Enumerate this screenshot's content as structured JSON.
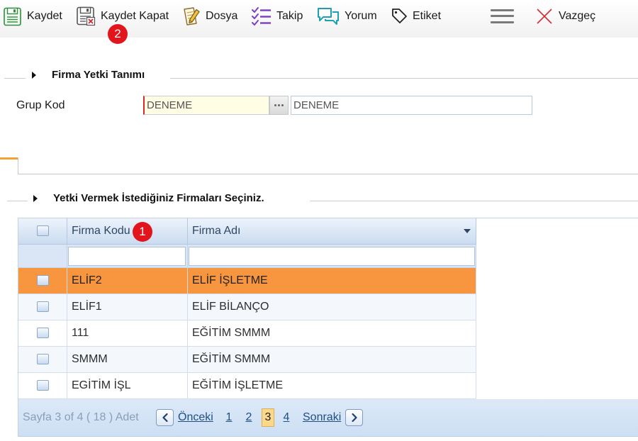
{
  "toolbar": {
    "items": [
      {
        "label": "Kaydet",
        "icon": "save-icon"
      },
      {
        "label": "Kaydet Kapat",
        "icon": "save-close-icon"
      },
      {
        "label": "Dosya",
        "icon": "file-edit-icon"
      },
      {
        "label": "Takip",
        "icon": "checklist-icon"
      },
      {
        "label": "Yorum",
        "icon": "comments-icon"
      },
      {
        "label": "Etiket",
        "icon": "tag-icon"
      }
    ],
    "menu_icon": "hamburger-menu-icon",
    "cancel": {
      "label": "Vazgeç",
      "icon": "close-icon"
    }
  },
  "annotations": {
    "marker_1": "1",
    "marker_2": "2"
  },
  "form": {
    "section_title": "Firma Yetki Tanımı",
    "group_code": {
      "label": "Grup Kod",
      "code_value": "DENEME",
      "name_value": "DENEME",
      "lookup_icon": "ellipsis-icon"
    }
  },
  "firm_selection": {
    "section_title": "Yetki Vermek İstediğiniz Firmaları Seçiniz."
  },
  "grid": {
    "columns": {
      "code": "Firma Kodu",
      "name": "Firma Adı"
    },
    "filters": {
      "code": "",
      "name": ""
    },
    "rows": [
      {
        "code": "ELİF2",
        "name": "ELİF İŞLETME",
        "selected": true,
        "checked": false
      },
      {
        "code": "ELİF1",
        "name": "ELİF BİLANÇO",
        "selected": false,
        "checked": false
      },
      {
        "code": "111",
        "name": "EĞİTİM SMMM",
        "selected": false,
        "checked": false
      },
      {
        "code": "SMMM",
        "name": "EĞİTİM SMMM",
        "selected": false,
        "checked": false
      },
      {
        "code": "EGİTİM İŞL",
        "name": "EĞİTİM İŞLETME",
        "selected": false,
        "checked": false
      }
    ]
  },
  "pager": {
    "summary": "Sayfa 3 of 4 ( 18 ) Adet",
    "prev_label": "Önceki",
    "next_label": "Sonraki",
    "pages": [
      "1",
      "2",
      "3",
      "4"
    ],
    "current_page": "3"
  },
  "colors": {
    "selected-row": "#f7963e",
    "required-border": "#e0262d",
    "required-background": "#fffde3",
    "marker": "#e3151c",
    "link": "#1f4f86",
    "current-page": "#fcd98a"
  }
}
